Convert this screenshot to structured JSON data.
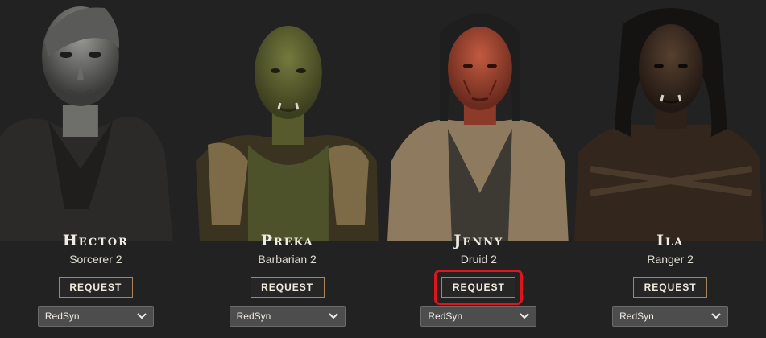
{
  "characters": [
    {
      "name": "Hector",
      "class": "Sorcerer 2",
      "request_label": "REQUEST",
      "player": "RedSyn",
      "skin": "#7a7a78",
      "hair": "#5c5c5a",
      "cloth": "#2d2b29"
    },
    {
      "name": "Preka",
      "class": "Barbarian 2",
      "request_label": "REQUEST",
      "player": "RedSyn",
      "skin": "#5d6132",
      "hair": "#4e5229",
      "cloth": "#3a3320"
    },
    {
      "name": "Jenny",
      "class": "Druid 2",
      "request_label": "REQUEST",
      "player": "RedSyn",
      "skin": "#a34a36",
      "hair": "#1e1e1e",
      "cloth": "#8e7a5e"
    },
    {
      "name": "Ila",
      "class": "Ranger 2",
      "request_label": "REQUEST",
      "player": "RedSyn",
      "skin": "#3b2b22",
      "hair": "#151312",
      "cloth": "#33261d"
    }
  ],
  "highlight_color": "#e0141b",
  "accent_border": "#a8845f"
}
